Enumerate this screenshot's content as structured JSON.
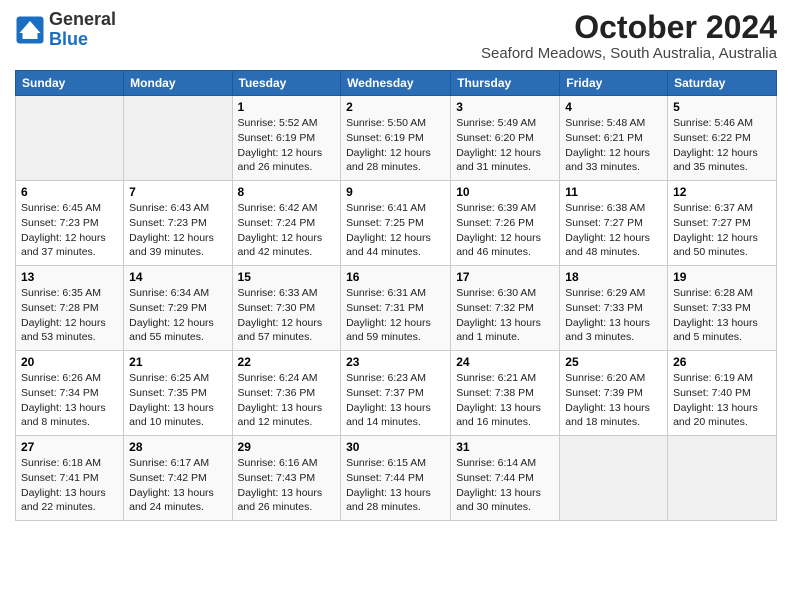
{
  "header": {
    "logo_general": "General",
    "logo_blue": "Blue",
    "month": "October 2024",
    "location": "Seaford Meadows, South Australia, Australia"
  },
  "days_of_week": [
    "Sunday",
    "Monday",
    "Tuesday",
    "Wednesday",
    "Thursday",
    "Friday",
    "Saturday"
  ],
  "weeks": [
    [
      {
        "day": "",
        "empty": true
      },
      {
        "day": "",
        "empty": true
      },
      {
        "day": "1",
        "sunrise": "Sunrise: 5:52 AM",
        "sunset": "Sunset: 6:19 PM",
        "daylight": "Daylight: 12 hours and 26 minutes."
      },
      {
        "day": "2",
        "sunrise": "Sunrise: 5:50 AM",
        "sunset": "Sunset: 6:19 PM",
        "daylight": "Daylight: 12 hours and 28 minutes."
      },
      {
        "day": "3",
        "sunrise": "Sunrise: 5:49 AM",
        "sunset": "Sunset: 6:20 PM",
        "daylight": "Daylight: 12 hours and 31 minutes."
      },
      {
        "day": "4",
        "sunrise": "Sunrise: 5:48 AM",
        "sunset": "Sunset: 6:21 PM",
        "daylight": "Daylight: 12 hours and 33 minutes."
      },
      {
        "day": "5",
        "sunrise": "Sunrise: 5:46 AM",
        "sunset": "Sunset: 6:22 PM",
        "daylight": "Daylight: 12 hours and 35 minutes."
      }
    ],
    [
      {
        "day": "6",
        "sunrise": "Sunrise: 6:45 AM",
        "sunset": "Sunset: 7:23 PM",
        "daylight": "Daylight: 12 hours and 37 minutes."
      },
      {
        "day": "7",
        "sunrise": "Sunrise: 6:43 AM",
        "sunset": "Sunset: 7:23 PM",
        "daylight": "Daylight: 12 hours and 39 minutes."
      },
      {
        "day": "8",
        "sunrise": "Sunrise: 6:42 AM",
        "sunset": "Sunset: 7:24 PM",
        "daylight": "Daylight: 12 hours and 42 minutes."
      },
      {
        "day": "9",
        "sunrise": "Sunrise: 6:41 AM",
        "sunset": "Sunset: 7:25 PM",
        "daylight": "Daylight: 12 hours and 44 minutes."
      },
      {
        "day": "10",
        "sunrise": "Sunrise: 6:39 AM",
        "sunset": "Sunset: 7:26 PM",
        "daylight": "Daylight: 12 hours and 46 minutes."
      },
      {
        "day": "11",
        "sunrise": "Sunrise: 6:38 AM",
        "sunset": "Sunset: 7:27 PM",
        "daylight": "Daylight: 12 hours and 48 minutes."
      },
      {
        "day": "12",
        "sunrise": "Sunrise: 6:37 AM",
        "sunset": "Sunset: 7:27 PM",
        "daylight": "Daylight: 12 hours and 50 minutes."
      }
    ],
    [
      {
        "day": "13",
        "sunrise": "Sunrise: 6:35 AM",
        "sunset": "Sunset: 7:28 PM",
        "daylight": "Daylight: 12 hours and 53 minutes."
      },
      {
        "day": "14",
        "sunrise": "Sunrise: 6:34 AM",
        "sunset": "Sunset: 7:29 PM",
        "daylight": "Daylight: 12 hours and 55 minutes."
      },
      {
        "day": "15",
        "sunrise": "Sunrise: 6:33 AM",
        "sunset": "Sunset: 7:30 PM",
        "daylight": "Daylight: 12 hours and 57 minutes."
      },
      {
        "day": "16",
        "sunrise": "Sunrise: 6:31 AM",
        "sunset": "Sunset: 7:31 PM",
        "daylight": "Daylight: 12 hours and 59 minutes."
      },
      {
        "day": "17",
        "sunrise": "Sunrise: 6:30 AM",
        "sunset": "Sunset: 7:32 PM",
        "daylight": "Daylight: 13 hours and 1 minute."
      },
      {
        "day": "18",
        "sunrise": "Sunrise: 6:29 AM",
        "sunset": "Sunset: 7:33 PM",
        "daylight": "Daylight: 13 hours and 3 minutes."
      },
      {
        "day": "19",
        "sunrise": "Sunrise: 6:28 AM",
        "sunset": "Sunset: 7:33 PM",
        "daylight": "Daylight: 13 hours and 5 minutes."
      }
    ],
    [
      {
        "day": "20",
        "sunrise": "Sunrise: 6:26 AM",
        "sunset": "Sunset: 7:34 PM",
        "daylight": "Daylight: 13 hours and 8 minutes."
      },
      {
        "day": "21",
        "sunrise": "Sunrise: 6:25 AM",
        "sunset": "Sunset: 7:35 PM",
        "daylight": "Daylight: 13 hours and 10 minutes."
      },
      {
        "day": "22",
        "sunrise": "Sunrise: 6:24 AM",
        "sunset": "Sunset: 7:36 PM",
        "daylight": "Daylight: 13 hours and 12 minutes."
      },
      {
        "day": "23",
        "sunrise": "Sunrise: 6:23 AM",
        "sunset": "Sunset: 7:37 PM",
        "daylight": "Daylight: 13 hours and 14 minutes."
      },
      {
        "day": "24",
        "sunrise": "Sunrise: 6:21 AM",
        "sunset": "Sunset: 7:38 PM",
        "daylight": "Daylight: 13 hours and 16 minutes."
      },
      {
        "day": "25",
        "sunrise": "Sunrise: 6:20 AM",
        "sunset": "Sunset: 7:39 PM",
        "daylight": "Daylight: 13 hours and 18 minutes."
      },
      {
        "day": "26",
        "sunrise": "Sunrise: 6:19 AM",
        "sunset": "Sunset: 7:40 PM",
        "daylight": "Daylight: 13 hours and 20 minutes."
      }
    ],
    [
      {
        "day": "27",
        "sunrise": "Sunrise: 6:18 AM",
        "sunset": "Sunset: 7:41 PM",
        "daylight": "Daylight: 13 hours and 22 minutes."
      },
      {
        "day": "28",
        "sunrise": "Sunrise: 6:17 AM",
        "sunset": "Sunset: 7:42 PM",
        "daylight": "Daylight: 13 hours and 24 minutes."
      },
      {
        "day": "29",
        "sunrise": "Sunrise: 6:16 AM",
        "sunset": "Sunset: 7:43 PM",
        "daylight": "Daylight: 13 hours and 26 minutes."
      },
      {
        "day": "30",
        "sunrise": "Sunrise: 6:15 AM",
        "sunset": "Sunset: 7:44 PM",
        "daylight": "Daylight: 13 hours and 28 minutes."
      },
      {
        "day": "31",
        "sunrise": "Sunrise: 6:14 AM",
        "sunset": "Sunset: 7:44 PM",
        "daylight": "Daylight: 13 hours and 30 minutes."
      },
      {
        "day": "",
        "empty": true
      },
      {
        "day": "",
        "empty": true
      }
    ]
  ]
}
